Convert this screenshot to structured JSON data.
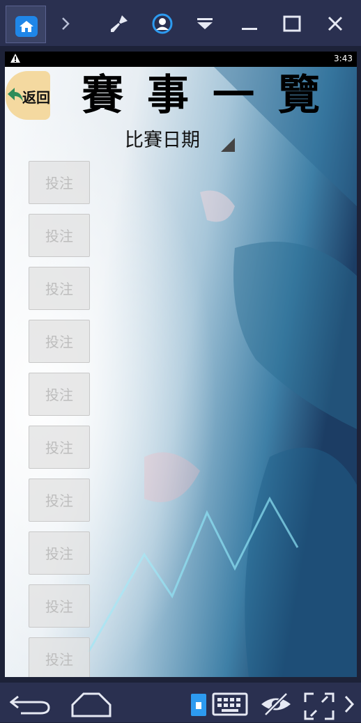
{
  "status_bar": {
    "time": "3:43",
    "warning_icon": "warning-icon"
  },
  "header": {
    "back_label": "返回",
    "title": "賽事一覽"
  },
  "date_select": {
    "label": "比賽日期"
  },
  "bet_buttons": [
    "投注",
    "投注",
    "投注",
    "投注",
    "投注",
    "投注",
    "投注",
    "投注",
    "投注",
    "投注"
  ],
  "colors": {
    "emulator_bar": "#2a3050",
    "home_accent": "#1f86e8",
    "back_button": "#f4d9a0"
  }
}
